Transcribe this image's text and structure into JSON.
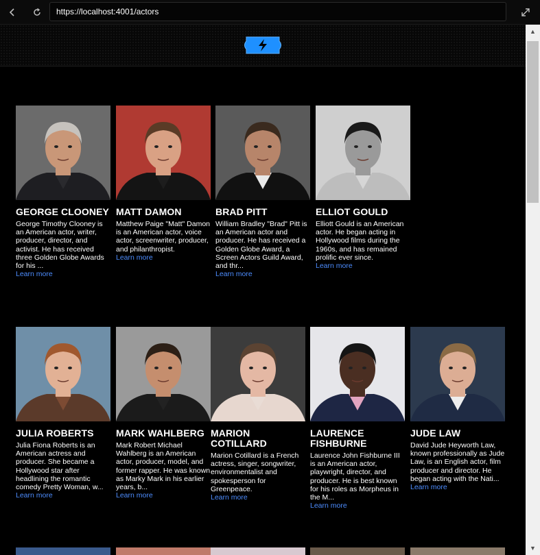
{
  "browser": {
    "url": "https://localhost:4001/actors"
  },
  "actors": [
    {
      "name": "GEORGE CLOONEY",
      "bio": "George Timothy Clooney is an American actor, writer, producer, director, and activist. He has received three Golden Globe Awards for his ...",
      "link": "Learn more",
      "photo": {
        "bg": "#6b6b6b",
        "skin": "#c99778",
        "hair": "#c6c2bd",
        "suit": "#1e1e22",
        "shirt": "#2a2a2e"
      }
    },
    {
      "name": "MATT DAMON",
      "bio": "Matthew Paige \"Matt\" Damon is an American actor, voice actor, screenwriter, producer, and philanthropist.",
      "link": "Learn more",
      "photo": {
        "bg": "#b03a32",
        "skin": "#d9a184",
        "hair": "#5a3b26",
        "suit": "#141414",
        "shirt": "#1d1d1d"
      }
    },
    {
      "name": "BRAD PITT",
      "bio": "William Bradley \"Brad\" Pitt is an American actor and producer. He has received a Golden Globe Award, a Screen Actors Guild Award, and thr...",
      "link": "Learn more",
      "photo": {
        "bg": "#5a5a5a",
        "skin": "#b7856a",
        "hair": "#3a2a1e",
        "suit": "#111",
        "shirt": "#e9e9e9"
      }
    },
    {
      "name": "ELLIOT GOULD",
      "bio": "Elliott Gould is an American actor. He began acting in Hollywood films during the 1960s, and has remained prolific ever since.",
      "link": "Learn more",
      "photo": {
        "bg": "#cfcfcf",
        "skin": "#9a9a9a",
        "hair": "#1a1a1a",
        "suit": "#bdbdbd",
        "shirt": "#d6d6d6"
      }
    },
    {
      "name": "JULIA ROBERTS",
      "bio": "Julia Fiona Roberts is an American actress and producer. She became a Hollywood star after headlining the romantic comedy Pretty Woman, w...",
      "link": "Learn more",
      "photo": {
        "bg": "#6f8fa8",
        "skin": "#e2b195",
        "hair": "#a0582e",
        "suit": "#5b3a2a",
        "shirt": "#7d4b33"
      }
    },
    {
      "name": "MARK WAHLBERG",
      "bio": "Mark Robert Michael Wahlberg is an American actor, producer, model, and former rapper. He was known as Marky Mark in his earlier years, b...",
      "link": "Learn more",
      "photo": {
        "bg": "#9a9a9a",
        "skin": "#c58e6e",
        "hair": "#2c1f16",
        "suit": "#1b1b1b",
        "shirt": "#222"
      }
    },
    {
      "name": "MARION COTILLARD",
      "bio": "Marion Cotillard is a French actress, singer, songwriter, environmentalist and spokesperson for Greenpeace.",
      "link": "Learn more",
      "photo": {
        "bg": "#3c3c3c",
        "skin": "#e4b8a4",
        "hair": "#5b4332",
        "suit": "#e7d7cf",
        "shirt": "#e9dcd5"
      }
    },
    {
      "name": "LAURENCE FISHBURNE",
      "bio": "Laurence John Fishburne III is an American actor, playwright, director, and producer. He is best known for his roles as Morpheus in the M...",
      "link": "Learn more",
      "photo": {
        "bg": "#e6e6ea",
        "skin": "#4a2e22",
        "hair": "#151515",
        "suit": "#1e2644",
        "shirt": "#e2a4c0"
      }
    },
    {
      "name": "JUDE LAW",
      "bio": "David Jude Heyworth Law, known professionally as Jude Law, is an English actor, film producer and director. He began acting with the Nati...",
      "link": "Learn more",
      "photo": {
        "bg": "#2c3a4e",
        "skin": "#dcad94",
        "hair": "#8a6a45",
        "suit": "#1f2b44",
        "shirt": "#eeeeee"
      }
    }
  ],
  "colors": {
    "link": "#4d8dff",
    "logo_fill": "#1e90ff",
    "logo_bolt": "#000000"
  }
}
